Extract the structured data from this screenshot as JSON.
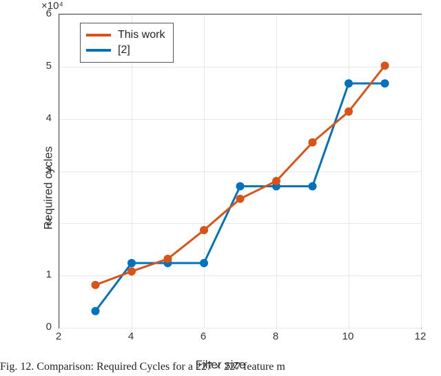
{
  "chart_data": {
    "type": "line",
    "title": "",
    "xlabel": "Filter size",
    "ylabel": "Required cycles",
    "exponent_label": "×10⁴",
    "xlim": [
      2,
      12
    ],
    "ylim": [
      0,
      60000
    ],
    "xticks": [
      2,
      4,
      6,
      8,
      10,
      12
    ],
    "yticks": [
      0,
      1,
      2,
      3,
      4,
      5,
      6
    ],
    "x": [
      3,
      4,
      5,
      6,
      7,
      8,
      9,
      10,
      11
    ],
    "series": [
      {
        "name": "This work",
        "color": "#d95319",
        "values": [
          8200,
          10800,
          13200,
          18700,
          24700,
          28100,
          35500,
          41400,
          50200
        ]
      },
      {
        "name": "[2]",
        "color": "#0072bd",
        "values": [
          3200,
          12400,
          12400,
          12400,
          27100,
          27100,
          27100,
          46800,
          46800
        ]
      }
    ],
    "marker_radius": 6
  },
  "caption": "Fig. 12. Comparison: Required Cycles for a 227 × 227 feature m"
}
